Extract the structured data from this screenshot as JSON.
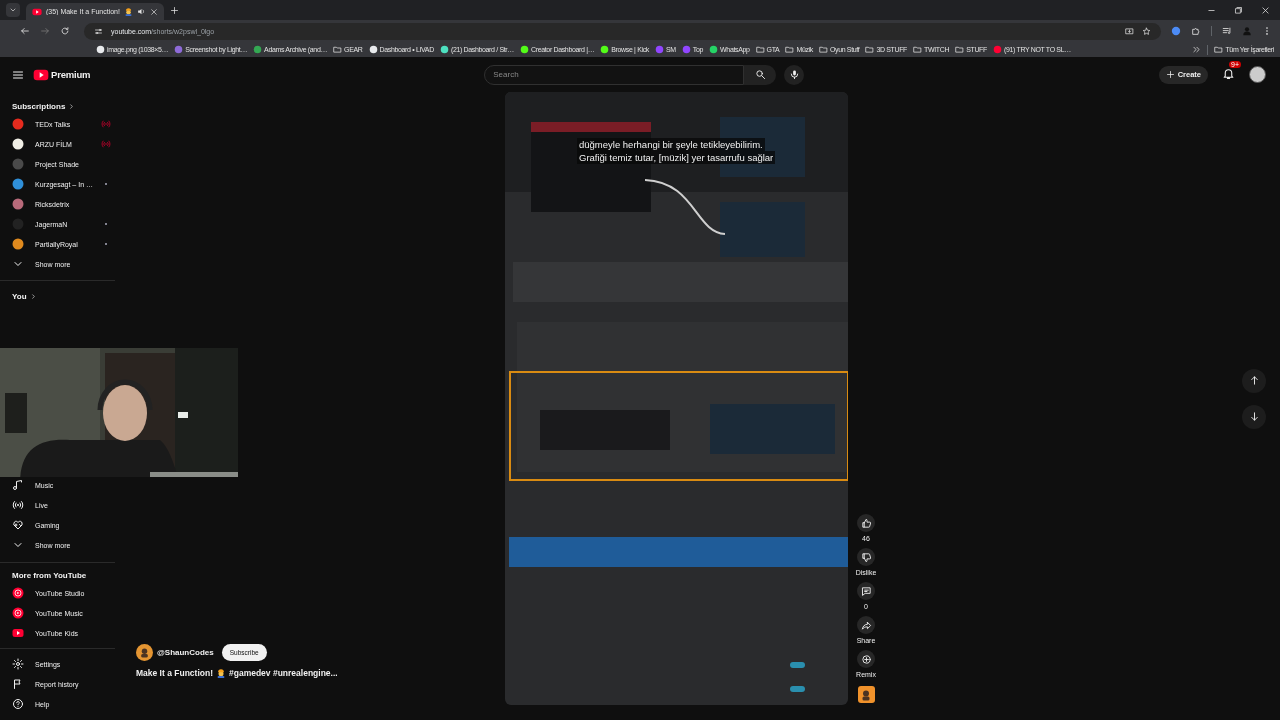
{
  "browser": {
    "tabs": [
      {
        "title": "(35) Make It a Function!",
        "selected": true,
        "audio": true
      }
    ],
    "address": {
      "host": "youtube.com",
      "path": "/shorts/w2pswl_0lgo"
    },
    "bookmarks": [
      {
        "label": "image.png (1038×5…",
        "kind": "page",
        "color": "#e8eaed"
      },
      {
        "label": "Screenshot by Light…",
        "kind": "page",
        "color": "#8e6bd8"
      },
      {
        "label": "Adams Archive (and…",
        "kind": "page",
        "color": "#34a853"
      },
      {
        "label": "GEAR",
        "kind": "folder"
      },
      {
        "label": "Dashboard • LIVAD",
        "kind": "page",
        "color": "#e8eaed"
      },
      {
        "label": "(21) Dashboard / Str…",
        "kind": "page",
        "color": "#4de0c0"
      },
      {
        "label": "Creator Dashboard |…",
        "kind": "page",
        "color": "#53fc18"
      },
      {
        "label": "Browse | Kick",
        "kind": "page",
        "color": "#53fc18"
      },
      {
        "label": "SM",
        "kind": "page",
        "color": "#9146ff"
      },
      {
        "label": "Top",
        "kind": "page",
        "color": "#9146ff"
      },
      {
        "label": "WhatsApp",
        "kind": "page",
        "color": "#25d366"
      },
      {
        "label": "GTA",
        "kind": "folder"
      },
      {
        "label": "Müzik",
        "kind": "folder"
      },
      {
        "label": "Oyun Stuff",
        "kind": "folder"
      },
      {
        "label": "3D STUFF",
        "kind": "folder"
      },
      {
        "label": "TWITCH",
        "kind": "folder"
      },
      {
        "label": "STUFF",
        "kind": "folder"
      },
      {
        "label": "(91) TRY NOT TO SL…",
        "kind": "page",
        "color": "#ff0033"
      }
    ],
    "all_bookmarks": "Tüm Yer İşaretleri"
  },
  "masthead": {
    "logo_badge": "Premium",
    "search_placeholder": "Search",
    "create": "Create",
    "notifications": "9+"
  },
  "sidebar": {
    "sections": [
      {
        "title": "Subscriptions",
        "items": [
          {
            "label": "TEDx Talks",
            "kind": "channel",
            "color": "#e62b1e",
            "live": true,
            "new_content": false
          },
          {
            "label": "ARZU FİLM",
            "kind": "channel",
            "color": "#f1efe6",
            "live": true,
            "new_content": false
          },
          {
            "label": "Project Shade",
            "kind": "channel",
            "color": "#4a4a4a",
            "live": false,
            "new_content": false
          },
          {
            "label": "Kurzgesagt – In …",
            "kind": "channel",
            "color": "#2f8fd8",
            "live": false,
            "new_content": true
          },
          {
            "label": "Ricksdetrix",
            "kind": "channel",
            "color": "#b86a7a",
            "live": false,
            "new_content": false
          },
          {
            "label": "JagermaN",
            "kind": "channel",
            "color": "#222222",
            "live": false,
            "new_content": true
          },
          {
            "label": "PartiallyRoyal",
            "kind": "channel",
            "color": "#e08a1e",
            "live": false,
            "new_content": true
          },
          {
            "label": "Show more",
            "kind": "more"
          }
        ]
      },
      {
        "title": "You"
      },
      {
        "items": [
          {
            "label": "Music",
            "kind": "music"
          },
          {
            "label": "Live",
            "kind": "live"
          },
          {
            "label": "Gaming",
            "kind": "gaming"
          },
          {
            "label": "Show more",
            "kind": "more"
          }
        ]
      },
      {
        "title": "More from YouTube",
        "items": [
          {
            "label": "YouTube Studio",
            "kind": "studio"
          },
          {
            "label": "YouTube Music",
            "kind": "ytmusic"
          },
          {
            "label": "YouTube Kids",
            "kind": "kids"
          }
        ]
      },
      {
        "items": [
          {
            "label": "Settings",
            "kind": "settings"
          },
          {
            "label": "Report history",
            "kind": "report"
          },
          {
            "label": "Help",
            "kind": "help"
          }
        ]
      }
    ]
  },
  "short": {
    "captions": [
      "düğmeyle herhangi bir şeyle tetikleyebilirim.",
      "Grafiği temiz tutar, [müzik] yer tasarrufu sağlar"
    ],
    "actions": [
      {
        "kind": "like",
        "label": "46"
      },
      {
        "kind": "dislike",
        "label": "Dislike"
      },
      {
        "kind": "comments",
        "label": "0"
      },
      {
        "kind": "share",
        "label": "Share"
      },
      {
        "kind": "remix",
        "label": "Remix"
      }
    ],
    "channel": "@ShaunCodes",
    "subscribe": "Subscribe",
    "title": "Make It a Function!",
    "hashtags": "#gamedev #unrealengine..."
  }
}
